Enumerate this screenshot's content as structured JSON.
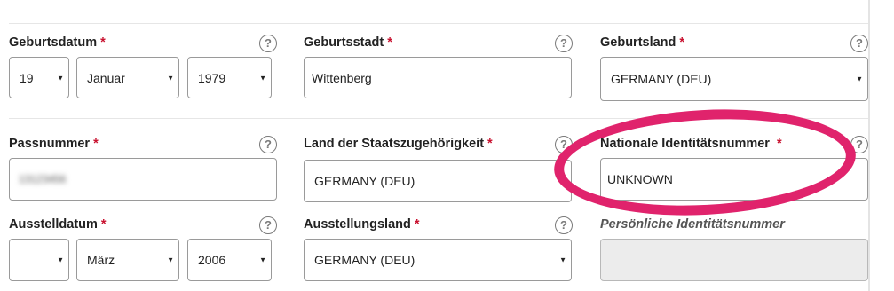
{
  "row1": {
    "geburtsdatum": {
      "label": "Geburtsdatum",
      "day": "19",
      "month": "Januar",
      "year": "1979"
    },
    "geburtsstadt": {
      "label": "Geburtsstadt",
      "value": "Wittenberg"
    },
    "geburtsland": {
      "label": "Geburtsland",
      "value": "GERMANY (DEU)"
    }
  },
  "row2": {
    "passnummer": {
      "label": "Passnummer",
      "value": "13123456"
    },
    "staatszugehoerigkeit": {
      "label": "Land der Staatszugehörigkeit",
      "value": "GERMANY (DEU)"
    },
    "nationale_id": {
      "label": "Nationale Identitätsnummer",
      "value": "UNKNOWN"
    }
  },
  "row3": {
    "ausstelldatum": {
      "label": "Ausstelldatum",
      "day": "",
      "month": "März",
      "year": "2006"
    },
    "ausstellungsland": {
      "label": "Ausstellungsland",
      "value": "GERMANY (DEU)"
    },
    "persoenliche_id": {
      "label": "Persönliche Identitätsnummer",
      "value": ""
    }
  },
  "common": {
    "required_mark": "*",
    "help_glyph": "?",
    "dropdown_glyph": "▼"
  },
  "colors": {
    "required": "#c8102e",
    "highlight": "#e0236c",
    "border": "#9a9a9a"
  }
}
